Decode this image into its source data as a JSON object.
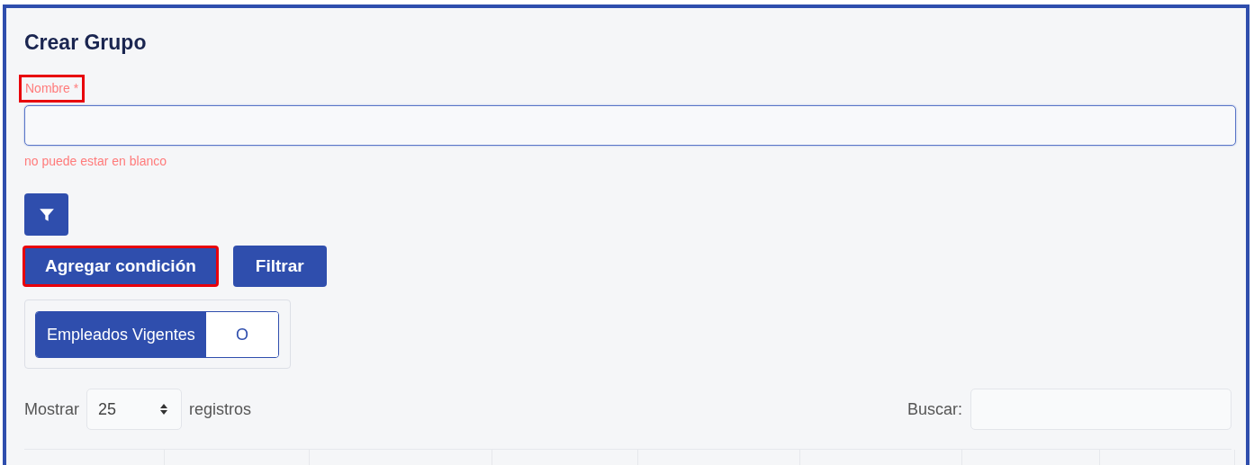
{
  "title": "Crear Grupo",
  "name_field": {
    "label": "Nombre *",
    "highlighted": true,
    "invalid": true,
    "error": "no puede estar en blanco"
  },
  "actions": [
    {
      "label": "Agregar condición",
      "highlighted": true
    },
    {
      "label": "Filtrar",
      "highlighted": false
    }
  ],
  "conditions": [
    {
      "label": "Empleados Vigentes",
      "operator": "O"
    }
  ],
  "length_control": {
    "prefix": "Mostrar",
    "value": "25",
    "suffix": "registros"
  },
  "search": {
    "label": "Buscar:"
  }
}
